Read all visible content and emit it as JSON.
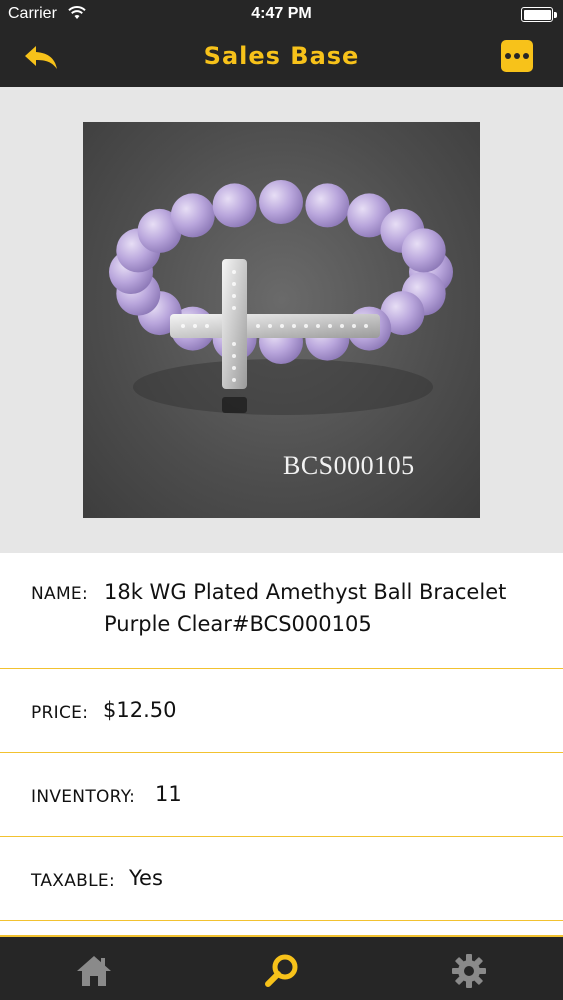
{
  "status_bar": {
    "carrier": "Carrier",
    "time": "4:47 PM",
    "wifi_icon": "wifi-icon",
    "battery_icon": "battery-icon"
  },
  "nav": {
    "title": "Sales Base",
    "back_icon": "back-arrow-icon",
    "menu_icon": "more-dots-icon",
    "accent_color": "#f7c21a"
  },
  "product_image": {
    "sku_overlay": "BCS000105"
  },
  "details": {
    "name_label": "NAME:",
    "name_value": "18k WG Plated Amethyst Ball Bracelet Purple Clear#BCS000105",
    "price_label": "PRICE:",
    "price_value": "$12.50",
    "inventory_label": "INVENTORY:",
    "inventory_value": "11",
    "taxable_label": "TAXABLE:",
    "taxable_value": "Yes"
  },
  "tab_bar": {
    "tabs": [
      {
        "icon": "home-icon",
        "active": false
      },
      {
        "icon": "search-icon",
        "active": true
      },
      {
        "icon": "gear-icon",
        "active": false
      }
    ]
  }
}
